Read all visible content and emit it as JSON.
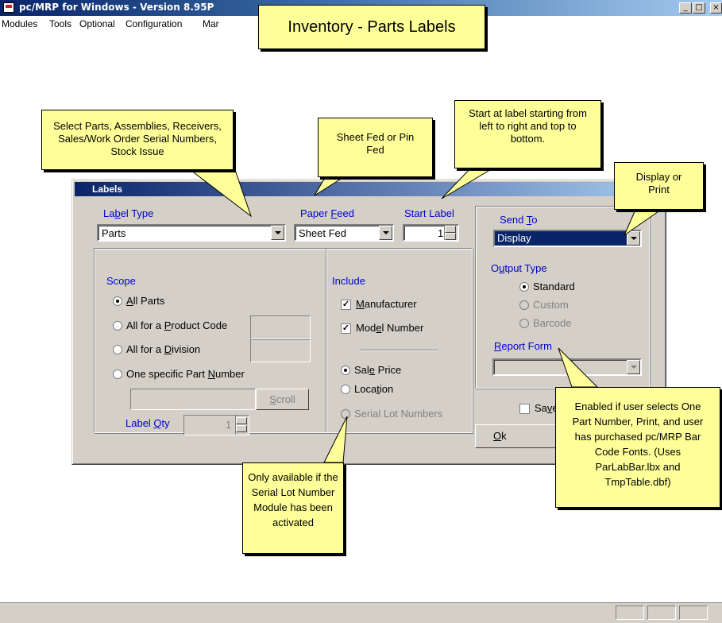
{
  "window": {
    "title": "pc/MRP for Windows - Version 8.95P",
    "min": "_",
    "max": "□",
    "close": "×"
  },
  "menu": [
    "Modules",
    "Tools",
    "Optional",
    "Configuration",
    "Mar"
  ],
  "banner": "Inventory - Parts Labels",
  "dialog": {
    "title": "Labels",
    "label_type": {
      "pre": "La",
      "key": "b",
      "post": "el Type",
      "value": "Parts"
    },
    "paper_feed": {
      "pre": "Paper ",
      "key": "F",
      "post": "eed",
      "value": "Sheet Fed"
    },
    "start_label": {
      "label": "Start Label",
      "value": "1"
    },
    "send_to": {
      "pre": "Send ",
      "key": "T",
      "post": "o",
      "value": "Display"
    },
    "output_type": {
      "pre": "O",
      "key": "u",
      "post": "tput Type",
      "options": [
        {
          "label": "Standard",
          "selected": true,
          "enabled": true
        },
        {
          "label": "Custom",
          "selected": false,
          "enabled": false
        },
        {
          "label": "Barcode",
          "selected": false,
          "enabled": false
        }
      ]
    },
    "report_form": {
      "key": "R",
      "post": "eport Form",
      "value": ""
    },
    "scope": {
      "title": "Scope",
      "options": [
        {
          "pre": "",
          "key": "A",
          "post": "ll Parts",
          "selected": true
        },
        {
          "pre": "All for a ",
          "key": "P",
          "post": "roduct Code",
          "selected": false
        },
        {
          "pre": "All for a ",
          "key": "D",
          "post": "ivision",
          "selected": false
        },
        {
          "pre": "One specific Part ",
          "key": "N",
          "post": "umber",
          "selected": false
        }
      ],
      "scroll": {
        "key": "S",
        "post": "croll"
      },
      "label_qty": {
        "pre": "Label ",
        "key": "Q",
        "post": "ty",
        "value": "1"
      }
    },
    "include": {
      "title": "Include",
      "manufacturer": {
        "key": "M",
        "post": "anufacturer",
        "checked": true
      },
      "model_number": {
        "pre": "Mod",
        "key": "e",
        "post": "l Number",
        "checked": true
      },
      "price_options": [
        {
          "pre": "Sal",
          "key": "e",
          "post": " Price",
          "selected": true,
          "enabled": true
        },
        {
          "pre": "Loca",
          "key": "t",
          "post": "ion",
          "selected": false,
          "enabled": true
        },
        {
          "pre": "Serial Lot Numbers",
          "key": "",
          "post": "",
          "selected": false,
          "enabled": false
        }
      ]
    },
    "save_label": {
      "pre": "Sa",
      "key": "v",
      "post": "e"
    },
    "ok": {
      "key": "O",
      "post": "k"
    }
  },
  "callouts": {
    "select_parts": "Select Parts, Assemblies, Receivers, Sales/Work Order Serial Numbers, Stock Issue",
    "sheet_fed": "Sheet Fed or Pin Fed",
    "start_at": "Start at label starting from left to right and top to bottom.",
    "display_print": "Display or Print",
    "enabled_if": "Enabled if user selects One Part Number, Print, and user has purchased pc/MRP Bar Code Fonts. (Uses ParLabBar.lbx and TmpTable.dbf)",
    "only_available": "Only available if the Serial Lot Number Module has been activated"
  }
}
